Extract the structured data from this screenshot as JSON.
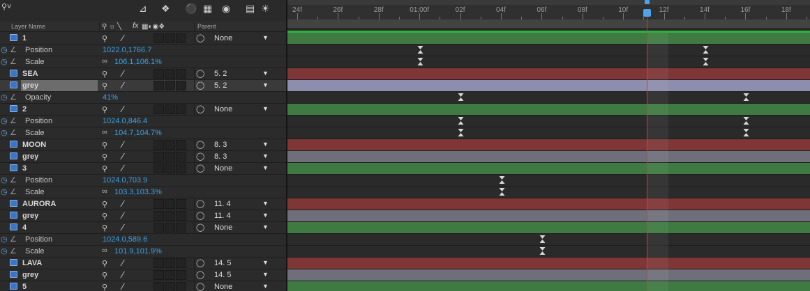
{
  "toolbar": {
    "icons": [
      "search-options-icon",
      "flowchart-icon",
      "draft-3d-icon",
      "shy-icon",
      "frame-blending-icon",
      "motion-blur-icon",
      "graph-editor-icon",
      "brainstorm-icon"
    ]
  },
  "columns": {
    "layer_name": "Layer Name",
    "parent": "Parent",
    "switch_fx": "fx"
  },
  "colors": {
    "accent": "#3aa2e4",
    "green_bar": "#3e7a42",
    "red_bar": "#7e3636",
    "grey_bar": "#6e6f7a",
    "selected_bar": "#8d8dad",
    "cti": "#4fa3e8",
    "cti_line": "#d23a3a"
  },
  "ruler": {
    "labels": [
      "24f",
      "26f",
      "28f",
      "01:00f",
      "02f",
      "04f",
      "06f",
      "08f",
      "10f",
      "12f",
      "14f",
      "16f",
      "18f"
    ]
  },
  "rows": [
    {
      "kind": "layer",
      "name": "1",
      "parent": "None",
      "bar": "green"
    },
    {
      "kind": "prop",
      "name": "Position",
      "value": "1022.0,1766.7",
      "keyframes": [
        3.0,
        17.0
      ]
    },
    {
      "kind": "prop",
      "name": "Scale",
      "value": "106.1,106.1%",
      "link": true,
      "keyframes": [
        3.0,
        17.0
      ]
    },
    {
      "kind": "layer",
      "name": "SEA",
      "parent": "5. 2",
      "bar": "red"
    },
    {
      "kind": "layer",
      "name": "grey",
      "parent": "5. 2",
      "bar": "lav",
      "selected": true
    },
    {
      "kind": "prop",
      "name": "Opacity",
      "value": "41%",
      "keyframes": [
        5.0,
        19.0
      ]
    },
    {
      "kind": "layer",
      "name": "2",
      "parent": "None",
      "bar": "green"
    },
    {
      "kind": "prop",
      "name": "Position",
      "value": "1024.0,846.4",
      "keyframes": [
        5.0,
        19.0
      ]
    },
    {
      "kind": "prop",
      "name": "Scale",
      "value": "104.7,104.7%",
      "link": true,
      "keyframes": [
        5.0,
        19.0
      ]
    },
    {
      "kind": "layer",
      "name": "MOON",
      "parent": "8. 3",
      "bar": "red"
    },
    {
      "kind": "layer",
      "name": "grey",
      "parent": "8. 3",
      "bar": "grey"
    },
    {
      "kind": "layer",
      "name": "3",
      "parent": "None",
      "bar": "green"
    },
    {
      "kind": "prop",
      "name": "Position",
      "value": "1024.0,703.9",
      "keyframes": [
        7.0
      ]
    },
    {
      "kind": "prop",
      "name": "Scale",
      "value": "103.3,103.3%",
      "link": true,
      "keyframes": [
        7.0
      ]
    },
    {
      "kind": "layer",
      "name": "AURORA",
      "parent": "11. 4",
      "bar": "red"
    },
    {
      "kind": "layer",
      "name": "grey",
      "parent": "11. 4",
      "bar": "grey"
    },
    {
      "kind": "layer",
      "name": "4",
      "parent": "None",
      "bar": "green"
    },
    {
      "kind": "prop",
      "name": "Position",
      "value": "1024.0,589.6",
      "keyframes": [
        9.0
      ]
    },
    {
      "kind": "prop",
      "name": "Scale",
      "value": "101.9,101.9%",
      "link": true,
      "keyframes": [
        9.0
      ]
    },
    {
      "kind": "layer",
      "name": "LAVA",
      "parent": "14. 5",
      "bar": "red"
    },
    {
      "kind": "layer",
      "name": "grey",
      "parent": "14. 5",
      "bar": "grey"
    },
    {
      "kind": "layer",
      "name": "5",
      "parent": "None",
      "bar": "green"
    }
  ]
}
